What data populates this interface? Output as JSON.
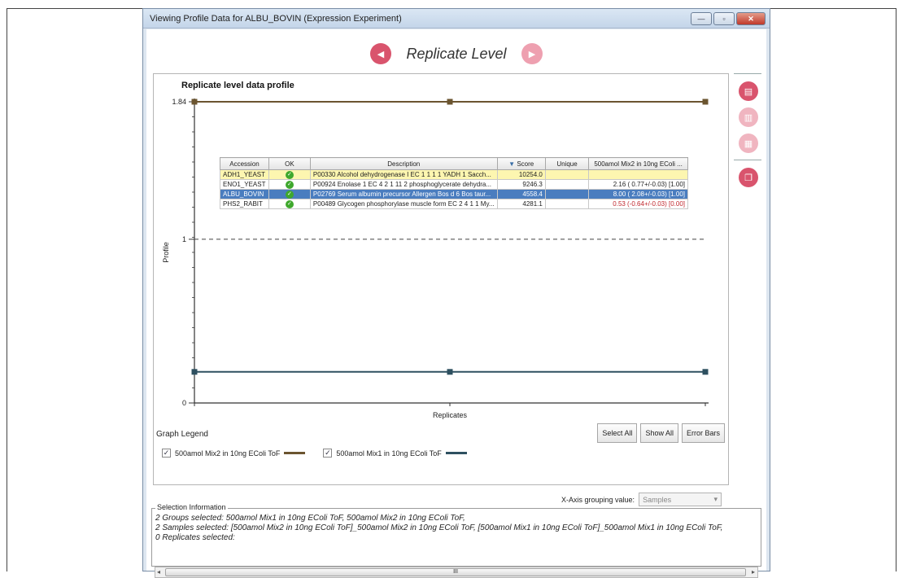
{
  "window": {
    "title": "Viewing Profile Data for ALBU_BOVIN (Expression Experiment)",
    "controls": {
      "minimize": "—",
      "restore": "▫",
      "close": "✕"
    }
  },
  "nav": {
    "title": "Replicate Level",
    "prev_icon": "left-arrow-icon",
    "next_icon": "right-arrow-icon"
  },
  "chart_data": {
    "type": "line",
    "title": "Replicate level data profile",
    "xlabel": "Replicates",
    "ylabel": "Profile",
    "ylim": [
      0,
      1.84
    ],
    "yticks": [
      "1.84",
      "1",
      "0"
    ],
    "reference_line": 1,
    "x": [
      0,
      1,
      2
    ],
    "series": [
      {
        "name": "500amol Mix2 in 10ng EColi ToF",
        "color": "#6b5530",
        "values": [
          1.84,
          1.84,
          1.84
        ]
      },
      {
        "name": "500amol Mix1 in 10ng EColi ToF",
        "color": "#2e5060",
        "values": [
          0.19,
          0.19,
          0.19
        ]
      }
    ],
    "grid": false
  },
  "table": {
    "headers": [
      "Accession",
      "OK",
      "Description",
      "Score",
      "Unique",
      "500amol Mix2 in 10ng EColi ..."
    ],
    "sort_icon": "sort-desc-icon",
    "rows": [
      {
        "accession": "ADH1_YEAST",
        "desc": "P00330 Alcohol dehydrogenase I EC 1 1 1 1 YADH 1 Sacch...",
        "score": "10254.0",
        "unique": "",
        "value": "",
        "style": "yellow"
      },
      {
        "accession": "ENO1_YEAST",
        "desc": "P00924 Enolase 1 EC 4 2 1 11 2 phosphoglycerate dehydra...",
        "score": "9246.3",
        "unique": "",
        "value": "2.16 ( 0.77+/-0.03) [1.00]",
        "style": ""
      },
      {
        "accession": "ALBU_BOVIN",
        "desc": "P02769 Serum albumin precursor Allergen Bos d 6 Bos taur...",
        "score": "4558.4",
        "unique": "",
        "value": "8.00 ( 2.08+/-0.03) [1.00]",
        "style": "sel"
      },
      {
        "accession": "PHS2_RABIT",
        "desc": "P00489 Glycogen phosphorylase muscle form EC 2 4 1 1 My...",
        "score": "4281.1",
        "unique": "",
        "value": "0.53 (-0.64+/-0.03) [0.00]",
        "style": ""
      }
    ]
  },
  "legend": {
    "label": "Graph Legend",
    "items": [
      {
        "label": "500amol Mix2 in 10ng EColi ToF",
        "color": "#6b5530",
        "checked": true
      },
      {
        "label": "500amol Mix1 in 10ng EColi ToF",
        "color": "#2e5060",
        "checked": true
      }
    ],
    "check_mark": "✓"
  },
  "buttons": {
    "select_all": "Select All",
    "show_all": "Show All",
    "error_bars": "Error Bars"
  },
  "xaxis_group": {
    "label": "X-Axis grouping value:",
    "value": "Samples"
  },
  "selection_info": {
    "title": "Selection Information",
    "lines": [
      "2 Groups selected: 500amol Mix1 in 10ng EColi ToF, 500amol Mix2 in 10ng EColi ToF,",
      "2 Samples selected: [500amol Mix2 in 10ng EColi ToF]_500amol Mix2 in 10ng EColi ToF, [500amol Mix1 in 10ng EColi ToF]_500amol Mix1 in 10ng EColi ToF,",
      "0 Replicates selected:"
    ]
  },
  "scrollbar": {
    "thumb_grip": "III",
    "left_arrow": "◂",
    "right_arrow": "▸"
  }
}
